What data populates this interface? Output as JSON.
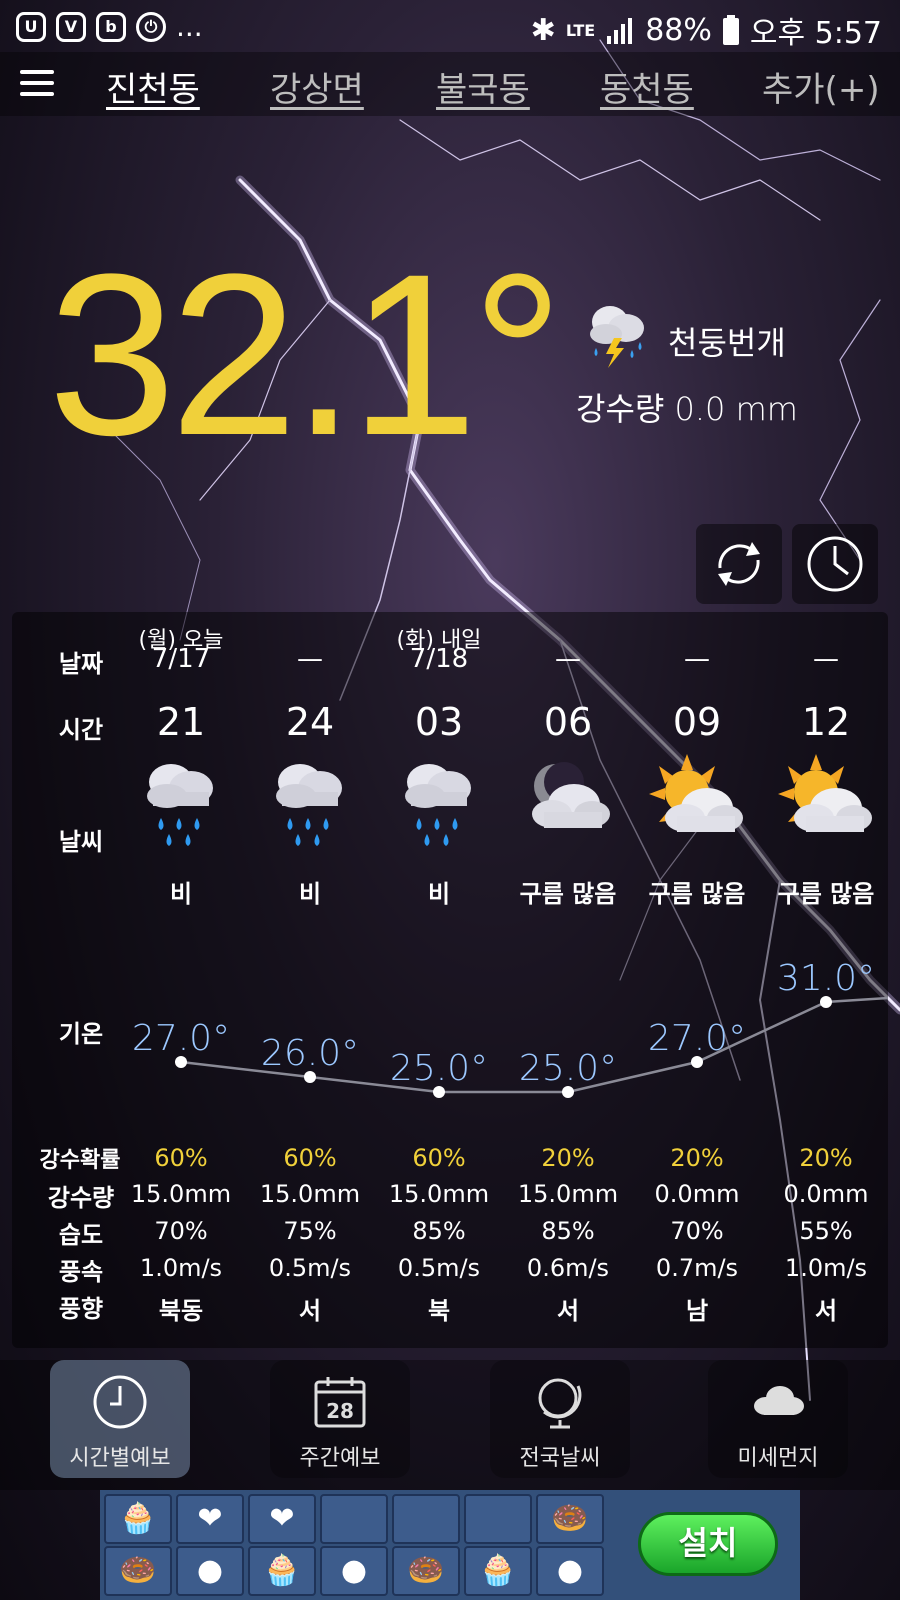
{
  "status_bar": {
    "app_icons": [
      "u-icon",
      "v-icon",
      "b-icon",
      "power-icon"
    ],
    "more": "...",
    "network": "LTE",
    "battery": "88%",
    "time": "오후 5:57"
  },
  "tabs": [
    {
      "label": "진천동",
      "active": true
    },
    {
      "label": "강상면",
      "active": false
    },
    {
      "label": "불국동",
      "active": false
    },
    {
      "label": "동천동",
      "active": false
    },
    {
      "label": "추가(+)",
      "active": false
    }
  ],
  "current": {
    "temperature": "32.1°",
    "condition": "천둥번개",
    "precipitation_label": "강수량",
    "precipitation_value": "0.0 mm"
  },
  "row_labels": {
    "date": "날짜",
    "time": "시간",
    "weather": "날씨",
    "temp": "기온",
    "pop": "강수확률",
    "amount": "강수량",
    "humidity": "습도",
    "wind_speed": "풍속",
    "wind_dir": "풍향"
  },
  "forecast": [
    {
      "day": "(월) 오늘",
      "date": "7/17",
      "hour": "21",
      "icon": "rain-icon",
      "desc": "비",
      "temp": "27.0°",
      "pop": "60%",
      "amount": "15.0mm",
      "humidity": "70%",
      "wind_speed": "1.0m/s",
      "wind_dir": "북동"
    },
    {
      "day": "",
      "date": "—",
      "hour": "24",
      "icon": "rain-icon",
      "desc": "비",
      "temp": "26.0°",
      "pop": "60%",
      "amount": "15.0mm",
      "humidity": "75%",
      "wind_speed": "0.5m/s",
      "wind_dir": "서"
    },
    {
      "day": "(화) 내일",
      "date": "7/18",
      "hour": "03",
      "icon": "rain-icon",
      "desc": "비",
      "temp": "25.0°",
      "pop": "60%",
      "amount": "15.0mm",
      "humidity": "85%",
      "wind_speed": "0.5m/s",
      "wind_dir": "북"
    },
    {
      "day": "",
      "date": "—",
      "hour": "06",
      "icon": "cloudy-night-icon",
      "desc": "구름 많음",
      "temp": "25.0°",
      "pop": "20%",
      "amount": "15.0mm",
      "humidity": "85%",
      "wind_speed": "0.6m/s",
      "wind_dir": "서"
    },
    {
      "day": "",
      "date": "—",
      "hour": "09",
      "icon": "cloudy-sun-icon",
      "desc": "구름 많음",
      "temp": "27.0°",
      "pop": "20%",
      "amount": "0.0mm",
      "humidity": "70%",
      "wind_speed": "0.7m/s",
      "wind_dir": "남"
    },
    {
      "day": "",
      "date": "—",
      "hour": "12",
      "icon": "cloudy-sun-icon",
      "desc": "구름 많음",
      "temp": "31.0°",
      "pop": "20%",
      "amount": "0.0mm",
      "humidity": "55%",
      "wind_speed": "1.0m/s",
      "wind_dir": "서"
    }
  ],
  "temp_values": [
    27.0,
    26.0,
    25.0,
    25.0,
    27.0,
    31.0
  ],
  "bottom_nav": [
    {
      "label": "시간별예보",
      "icon": "clock-icon",
      "active": true
    },
    {
      "label": "주간예보",
      "icon": "calendar-icon",
      "calendar_day": "28",
      "active": false
    },
    {
      "label": "전국날씨",
      "icon": "globe-icon",
      "active": false
    },
    {
      "label": "미세먼지",
      "icon": "cloud-icon",
      "active": false
    }
  ],
  "ad": {
    "install_label": "설치"
  },
  "colors": {
    "accent_yellow": "#f0d03a",
    "temp_blue": "#9cc8ff",
    "panel_bg": "rgba(0,0,0,0.48)"
  }
}
